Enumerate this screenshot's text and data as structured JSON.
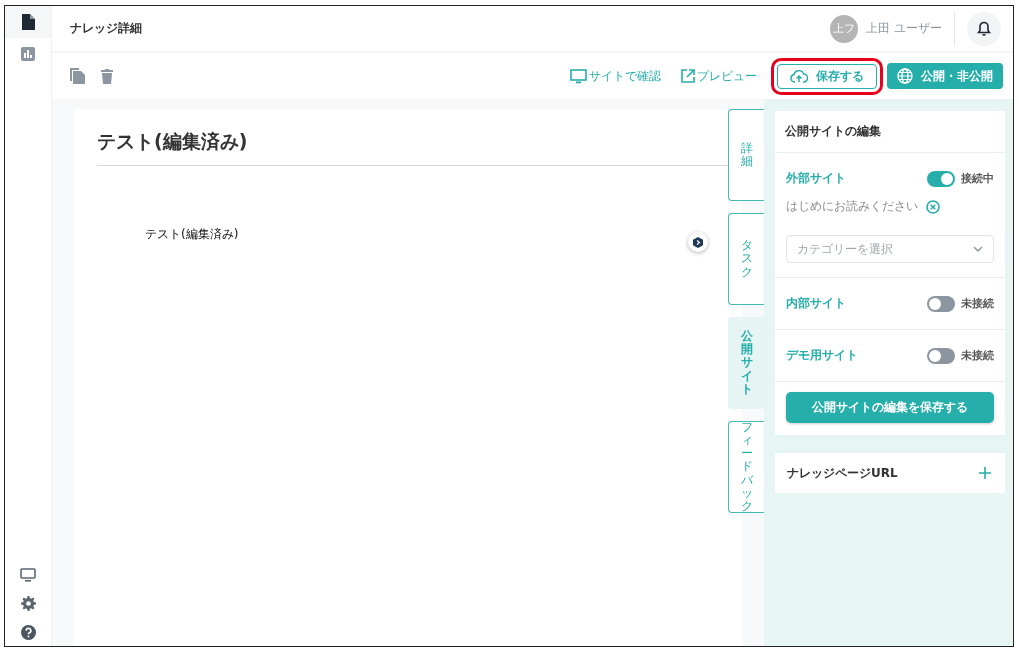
{
  "sidebar": {
    "items": [
      {
        "selected": true
      },
      {
        "selected": false
      }
    ]
  },
  "header": {
    "title": "ナレッジ詳細",
    "avatar": "上フ",
    "user_name": "上田 ユーザー"
  },
  "toolbar": {
    "links": [
      {
        "label": "サイトで確認"
      },
      {
        "label": "プレビュー"
      }
    ],
    "save_button": {
      "label": "保存する",
      "highlighted": true
    },
    "publish_button": {
      "label": "公開・非公開"
    }
  },
  "editor": {
    "title": "テスト(編集済み)",
    "body": "テスト(編集済み)"
  },
  "side_tabs": [
    {
      "label": "詳細",
      "selected": false
    },
    {
      "label": "タスク",
      "selected": false
    },
    {
      "label": "公開サイト",
      "selected": true
    },
    {
      "label": "フィードバック",
      "selected": false
    }
  ],
  "panel": {
    "title": "公開サイトの編集",
    "sites": [
      {
        "name": "外部サイト",
        "on": true,
        "status": "接続中",
        "note": "はじめにお読みください",
        "category_placeholder": "カテゴリーを選択"
      },
      {
        "name": "内部サイト",
        "on": false,
        "status": "未接続"
      },
      {
        "name": "デモ用サイト",
        "on": false,
        "status": "未接続"
      }
    ],
    "save_button": "公開サイトの編集を保存する",
    "url_section": "ナレッジページURL"
  }
}
